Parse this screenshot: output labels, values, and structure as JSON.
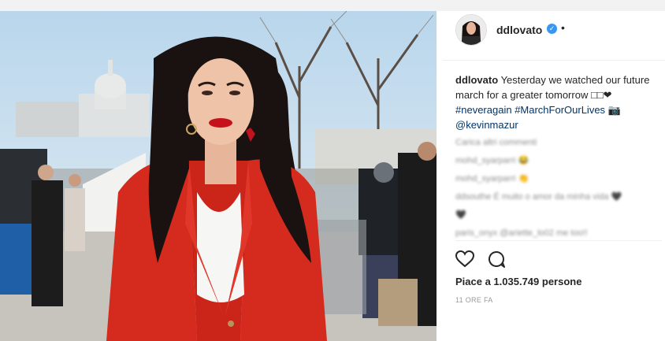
{
  "post": {
    "username": "ddlovato",
    "verified_icon": "verified-badge-icon",
    "more_dot": "•",
    "caption": {
      "username": "ddlovato",
      "text": "Yesterday we watched our future march for a greater tomorrow □□❤",
      "hashtag1": "#neveragain",
      "hashtag2": "#MarchForOurLives",
      "camera_icon": "📷",
      "mention": "@kevinmazur"
    },
    "comments_blurred": [
      "Carica altri commenti",
      "mohd_syarparri 😂",
      "mohd_syarparri 👏",
      "ddsouthe É muito o amor da minha vida 🖤",
      "🖤",
      "paris_onyx @ariette_lo02 me too!!"
    ],
    "like_icon": "heart-icon",
    "comment_icon": "comment-icon",
    "likes_text": "Piace a 1.035.749 persone",
    "timestamp": "11 ORE FA"
  },
  "colors": {
    "blazer": "#d52b1e",
    "link": "#003569",
    "verified": "#3897f0"
  }
}
